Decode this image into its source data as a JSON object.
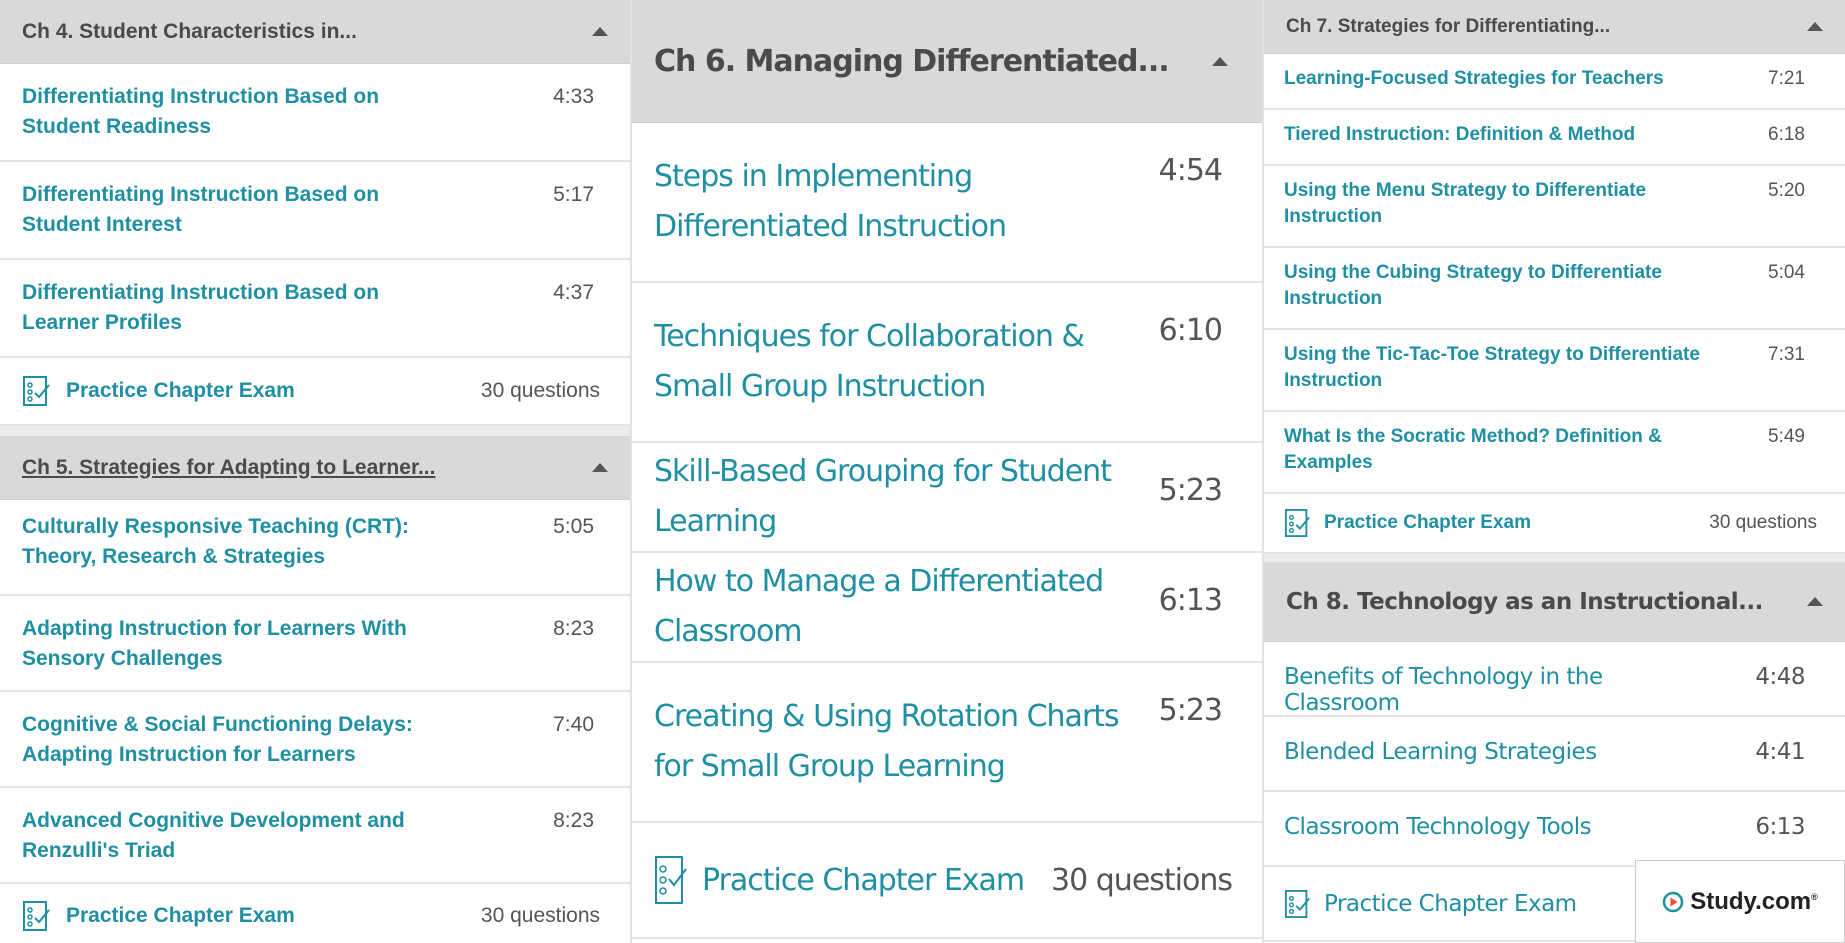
{
  "col1": {
    "ch4": {
      "title": "Ch 4. Student Characteristics in...",
      "lessons": [
        {
          "title": "Differentiating Instruction Based on Student Readiness",
          "duration": "4:33"
        },
        {
          "title": "Differentiating Instruction Based on Student Interest",
          "duration": "5:17"
        },
        {
          "title": "Differentiating Instruction Based on Learner Profiles",
          "duration": "4:37"
        }
      ],
      "exam_label": "Practice Chapter Exam",
      "exam_count": "30 questions"
    },
    "ch5": {
      "title": "Ch 5. Strategies for Adapting to Learner...",
      "lessons": [
        {
          "title": "Culturally Responsive Teaching (CRT): Theory, Research & Strategies",
          "duration": "5:05"
        },
        {
          "title": "Adapting Instruction for Learners With Sensory Challenges",
          "duration": "8:23"
        },
        {
          "title": "Cognitive & Social Functioning Delays: Adapting Instruction for Learners",
          "duration": "7:40"
        },
        {
          "title": "Advanced Cognitive Development and Renzulli's Triad",
          "duration": "8:23"
        }
      ],
      "exam_label": "Practice Chapter Exam",
      "exam_count": "30 questions"
    }
  },
  "col2": {
    "ch6": {
      "title": "Ch 6. Managing Differentiated...",
      "lessons": [
        {
          "title": "Steps in Implementing Differentiated Instruction",
          "duration": "4:54"
        },
        {
          "title": "Techniques for Collaboration & Small Group Instruction",
          "duration": "6:10"
        },
        {
          "title": "Skill-Based Grouping for Student Learning",
          "duration": "5:23"
        },
        {
          "title": "How to Manage a Differentiated Classroom",
          "duration": "6:13"
        },
        {
          "title": "Creating & Using Rotation Charts for Small Group Learning",
          "duration": "5:23"
        }
      ],
      "exam_label": "Practice Chapter Exam",
      "exam_count": "30 questions"
    }
  },
  "col3": {
    "ch7": {
      "title": "Ch 7. Strategies for Differentiating...",
      "lessons": [
        {
          "title": "Learning-Focused Strategies for Teachers",
          "duration": "7:21"
        },
        {
          "title": "Tiered Instruction: Definition & Method",
          "duration": "6:18"
        },
        {
          "title": "Using the Menu Strategy to Differentiate Instruction",
          "duration": "5:20"
        },
        {
          "title": "Using the Cubing Strategy to Differentiate Instruction",
          "duration": "5:04"
        },
        {
          "title": "Using the Tic-Tac-Toe Strategy to Differentiate Instruction",
          "duration": "7:31"
        },
        {
          "title": "What Is the Socratic Method? Definition & Examples",
          "duration": "5:49"
        }
      ],
      "exam_label": "Practice Chapter Exam",
      "exam_count": "30 questions"
    },
    "ch8": {
      "title": "Ch 8. Technology as an Instructional...",
      "lessons": [
        {
          "title": "Benefits of Technology in the Classroom",
          "duration": "4:48"
        },
        {
          "title": "Blended Learning Strategies",
          "duration": "4:41"
        },
        {
          "title": "Classroom Technology Tools",
          "duration": "6:13"
        }
      ],
      "exam_label": "Practice Chapter Exam"
    }
  },
  "logo": {
    "text": "Study.com",
    "mark": "®"
  },
  "colors": {
    "link": "#1f8fa3",
    "header_bg": "#d9d9d9",
    "text": "#4a4a4a",
    "duration": "#555555"
  }
}
